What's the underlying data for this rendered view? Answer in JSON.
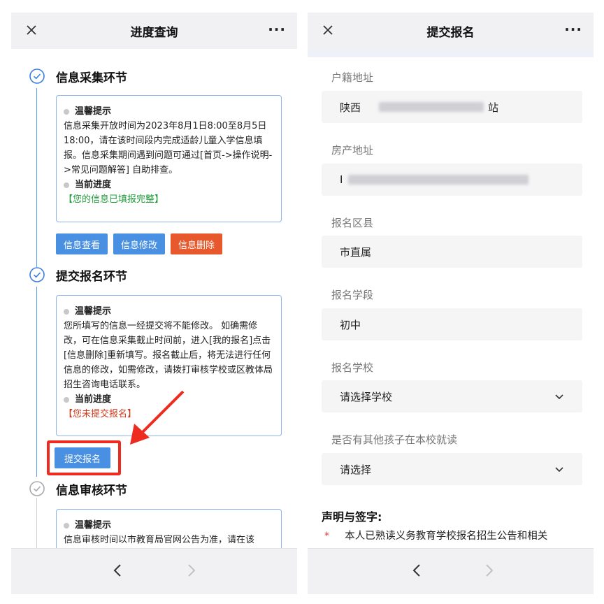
{
  "left": {
    "title": "进度查询",
    "steps": [
      {
        "title": "信息采集环节",
        "tip_head": "温馨提示",
        "tip_body": "信息采集开放时间为2023年8月1日8:00至8月5日18:00，请在该时间段内完成适龄儿童入学信息填报。信息采集期间遇到问题可通过[首页->操作说明->常见问题解答] 自助排查。",
        "progress_head": "当前进度",
        "progress_status": "【您的信息已填报完整】",
        "buttons": [
          "信息查看",
          "信息修改",
          "信息删除"
        ]
      },
      {
        "title": "提交报名环节",
        "tip_head": "温馨提示",
        "tip_body": "您所填写的信息一经提交将不能修改。 如确需修改，可在信息采集截止时间前，进入[我的报名]点击[信息删除]重新填写。报名截止后，将无法进行任何信息的修改，如需修改，请拨打审核学校或区教体局招生咨询电话联系。",
        "progress_head": "当前进度",
        "progress_status": "【您未提交报名】",
        "buttons": [
          "提交报名"
        ]
      },
      {
        "title": "信息审核环节",
        "tip_head": "温馨提示",
        "tip_body": "信息审核时间以市教育局官网公告为准，请在该"
      }
    ]
  },
  "right": {
    "title": "提交报名",
    "fields": [
      {
        "label": "户籍地址",
        "value_prefix": "陕西",
        "value_suffix": "站"
      },
      {
        "label": "房产地址",
        "value_prefix": "I",
        "value_suffix": ""
      },
      {
        "label": "报名区县",
        "value": "市直属"
      },
      {
        "label": "报名学段",
        "value": "初中"
      },
      {
        "label": "报名学校",
        "value": "请选择学校"
      },
      {
        "label": "是否有其他孩子在本校就读",
        "value": "请选择"
      }
    ],
    "declaration_title": "声明与签字:",
    "declaration_star": "*",
    "declaration_text": "本人已熟读义务教育学校报名招生公告和相关"
  },
  "icons": {
    "close": "close-icon",
    "more": "more-icon",
    "check": "check-circle-icon",
    "back": "chevron-left-icon",
    "forward": "chevron-right-icon",
    "dropdown": "chevron-down-icon"
  },
  "more_glyph": "···",
  "colors": {
    "accent_blue": "#4a90e2",
    "danger_orange": "#e8582d",
    "status_green": "#1f9a3a",
    "status_red": "#d23a1e",
    "annotation_red": "#ee2b1f"
  }
}
